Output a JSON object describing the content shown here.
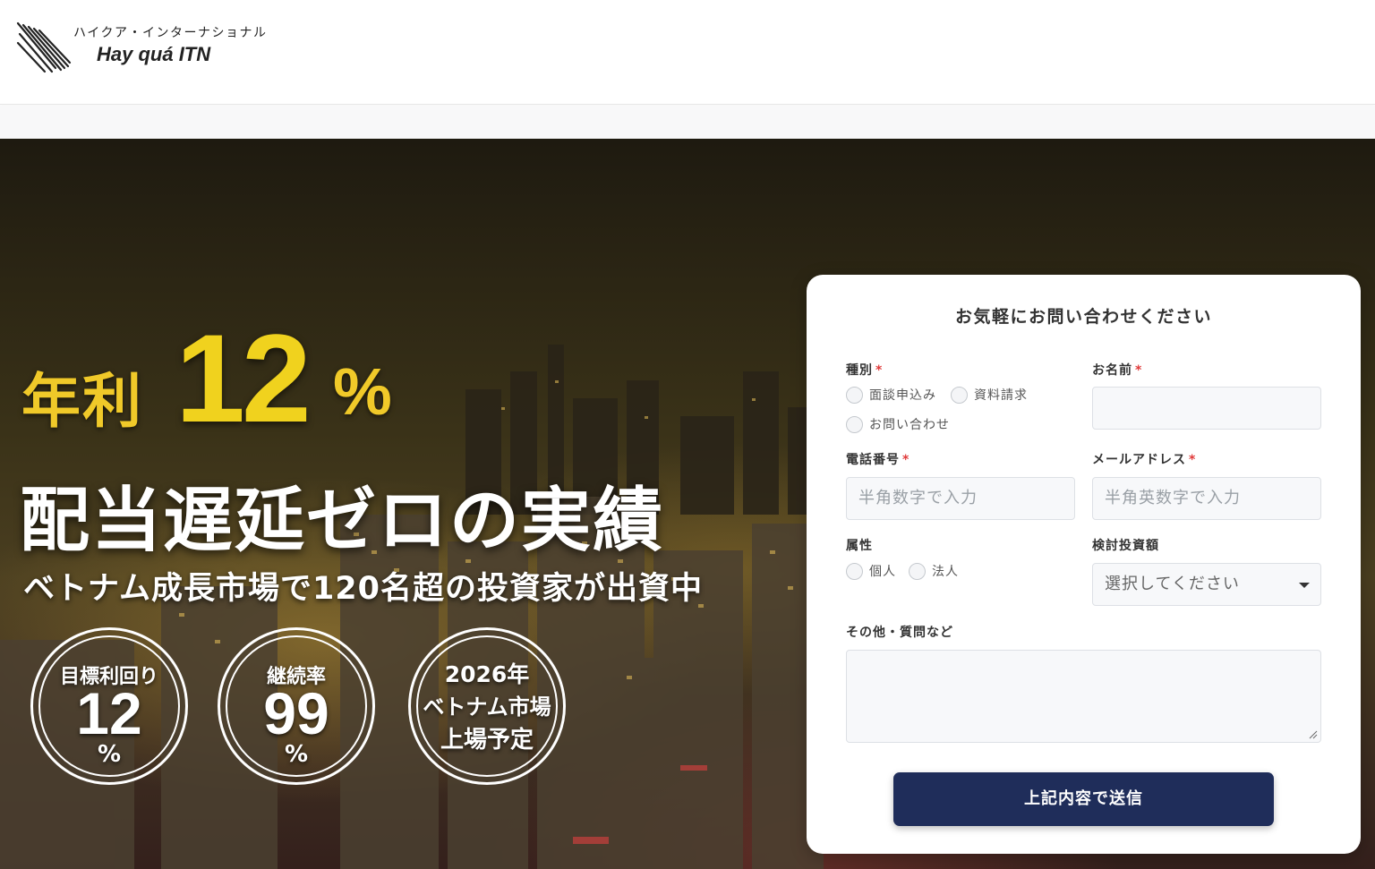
{
  "header": {
    "logo_kana": "ハイクア・インターナショナル",
    "logo_name": "Hay quá ITN"
  },
  "hero": {
    "headline_prefix": "年利",
    "headline_number": "12",
    "headline_unit": "%",
    "main_copy": "配当遅延ゼロの実績",
    "sub_copy": "ベトナム成長市場で120名超の投資家が出資中",
    "badges": [
      {
        "label": "目標利回り",
        "number": "12",
        "unit": "%"
      },
      {
        "label": "継続率",
        "number": "99",
        "unit": "%"
      },
      {
        "lines": [
          "2026年",
          "ベトナム市場",
          "上場予定"
        ]
      }
    ]
  },
  "form": {
    "title": "お気軽にお問い合わせください",
    "required_mark": "*",
    "type": {
      "label": "種別",
      "options": [
        "面談申込み",
        "資料請求",
        "お問い合わせ"
      ]
    },
    "name": {
      "label": "お名前",
      "value": ""
    },
    "phone": {
      "label": "電話番号",
      "placeholder": "半角数字で入力"
    },
    "email": {
      "label": "メールアドレス",
      "placeholder": "半角英数字で入力"
    },
    "attribute": {
      "label": "属性",
      "options": [
        "個人",
        "法人"
      ]
    },
    "amount": {
      "label": "検討投資額",
      "selected": "選択してください"
    },
    "other": {
      "label": "その他・質問など",
      "value": ""
    },
    "submit_label": "上記内容で送信"
  },
  "colors": {
    "accent_yellow": "#f0c929",
    "submit_navy": "#1f2d5a",
    "required_red": "#e03a3a"
  }
}
